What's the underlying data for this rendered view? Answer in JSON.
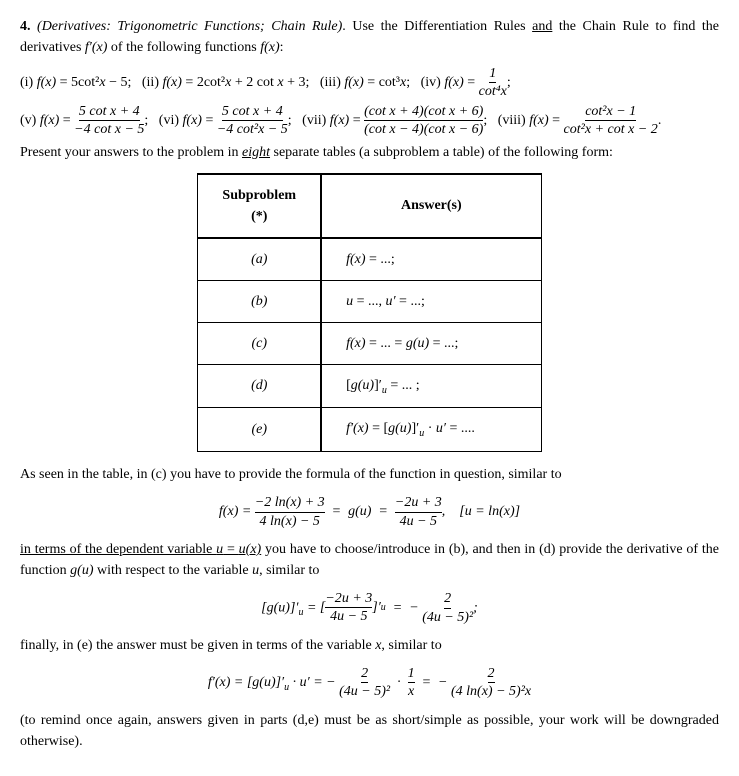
{
  "problem": {
    "number": "4.",
    "title": "(Derivatives: Trigonometric Functions; Chain Rule).",
    "instruction": "Use the Differentiation Rules",
    "instruction2": "and the Chain Rule to find the derivatives",
    "fprime": "f′(x)",
    "of": "of the following functions",
    "fx": "f(x):",
    "present_text": "Present your answers to the problem in",
    "eight": "eight",
    "separate": "separate tables (a subproblem a table) of the following form:",
    "subproblem_header": "Subproblem (*)",
    "answer_header": "Answer(s)",
    "rows": [
      {
        "label": "(a)",
        "answer": "f(x) = ...;"
      },
      {
        "label": "(b)",
        "answer": "u = ..., u′ = ...;"
      },
      {
        "label": "(c)",
        "answer": "f(x) = ... = g(u) = ...;"
      },
      {
        "label": "(d)",
        "answer": "[g(u)]′ᵤ = ... ;"
      },
      {
        "label": "(e)",
        "answer": "f′(x) = [g(u)]′ᵤ · u′ = ...."
      }
    ],
    "as_seen_intro": "As seen in the table, in (c) you have to provide the formula of the function in question, similar to",
    "in_terms_text": "in terms of the dependent variable",
    "uux": "u = u(x)",
    "you_have": "you have to choose/introduce in (b), and then in (d) provide the derivative of the function",
    "gu": "g(u)",
    "with_respect": "with respect to the variable",
    "u_var": "u,",
    "similar_to": "similar to",
    "finally_text": "finally, in (e) the answer must be given in terms of the variable",
    "x_var": "x,",
    "similar_to2": "similar to",
    "remind_text": "(to remind once again, answers given in parts (d,e) must be as short/simple as possible, your work will be downgraded otherwise)."
  }
}
